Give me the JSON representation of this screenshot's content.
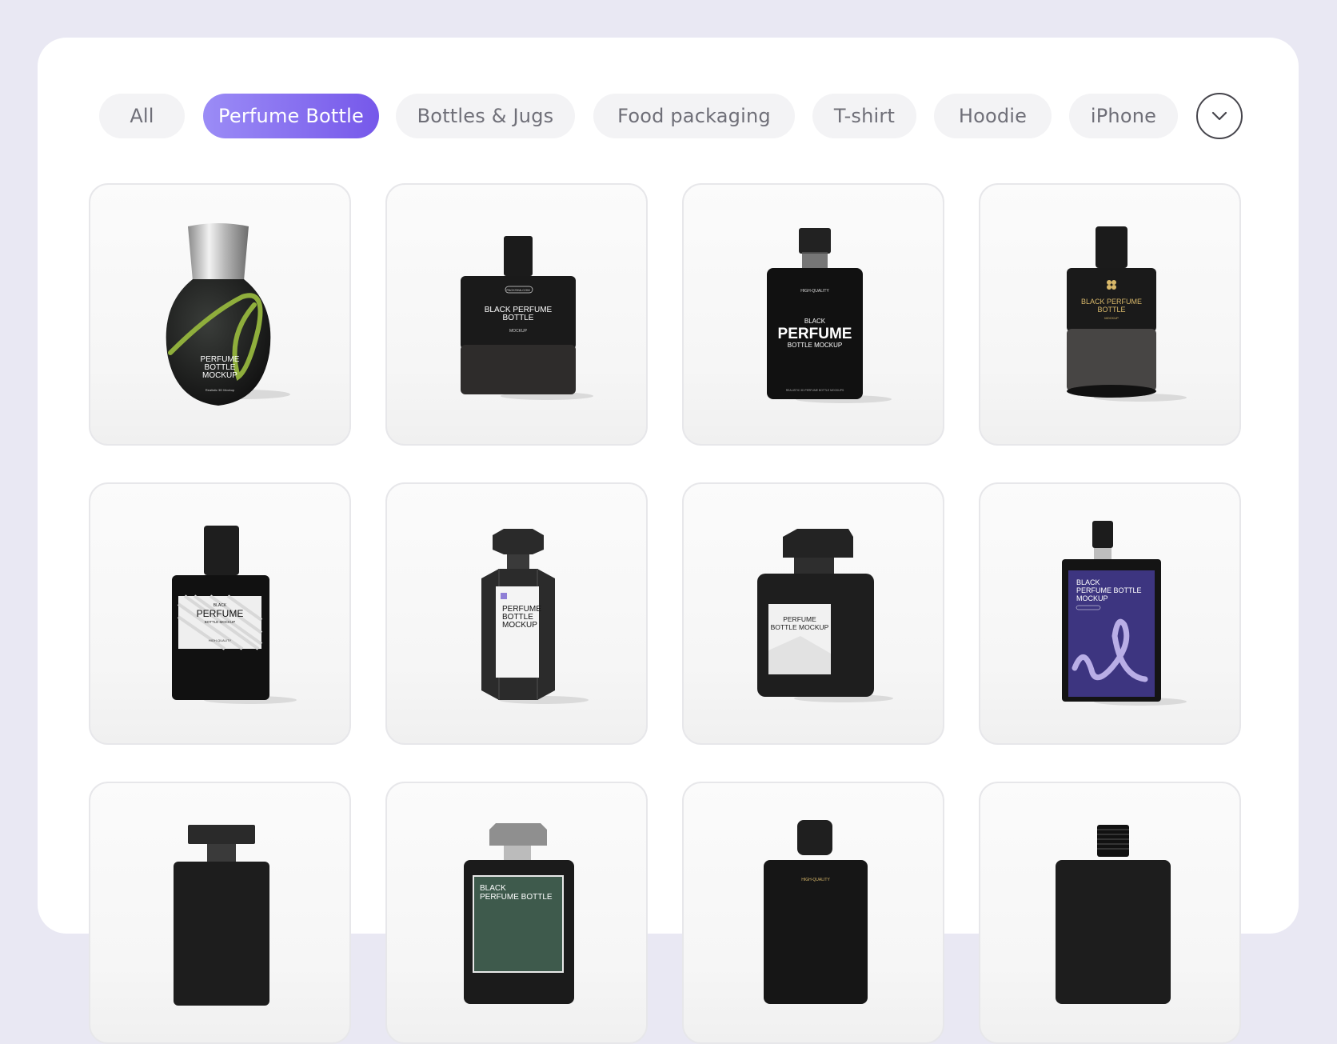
{
  "filters": [
    {
      "label": "All",
      "active": false
    },
    {
      "label": "Perfume Bottle",
      "active": true
    },
    {
      "label": "Bottles & Jugs",
      "active": false
    },
    {
      "label": "Food packaging",
      "active": false
    },
    {
      "label": "T-shirt",
      "active": false
    },
    {
      "label": "Hoodie",
      "active": false
    },
    {
      "label": "iPhone",
      "active": false
    }
  ],
  "more_icon": "chevron-down-icon",
  "colors": {
    "accent_start": "#9b8cf6",
    "accent_end": "#7658ea",
    "page_bg": "#e9e8f3",
    "chip_bg": "#f3f3f5",
    "purple_label": "#3d3580",
    "green_label": "#3e5a4c"
  },
  "grid": [
    {
      "labels": [
        "PERFUME",
        "BOTTLE",
        "MOCKUP"
      ],
      "small": "Realistic 3D Mockup"
    },
    {
      "labels": [
        "BLACK PERFUME",
        "BOTTLE"
      ],
      "top": "PACKSHA.COM",
      "small": "MOCKUP"
    },
    {
      "labels": [
        "PERFUME"
      ],
      "top": "HIGH-QUALITY",
      "pre": "BLACK",
      "sub": "BOTTLE MOCKUP",
      "small": "REALISTIC 3D PERFUME BOTTLE MOCKUPS"
    },
    {
      "labels": [
        "BLACK PERFUME",
        "BOTTLE"
      ],
      "small": "MOCKUP"
    },
    {
      "labels": [
        "PERFUME"
      ],
      "pre": "BLACK",
      "sub": "BOTTLE MOCKUP",
      "small": "HIGH-QUALITY"
    },
    {
      "labels": [
        "PERFUME",
        "BOTTLE",
        "MOCKUP"
      ]
    },
    {
      "labels": [
        "PERFUME",
        "BOTTLE MOCKUP"
      ]
    },
    {
      "labels": [
        "BLACK",
        "PERFUME BOTTLE",
        "MOCKUP"
      ]
    },
    {
      "labels": []
    },
    {
      "labels": [
        "BLACK",
        "PERFUME BOTTLE"
      ]
    },
    {
      "labels": [],
      "top": "HIGH-QUALITY"
    },
    {
      "labels": []
    }
  ]
}
